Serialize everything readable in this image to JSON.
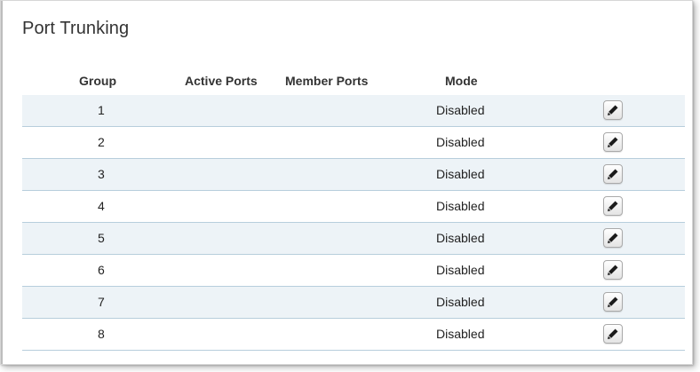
{
  "page": {
    "title": "Port Trunking"
  },
  "table": {
    "headers": {
      "group": "Group",
      "active_ports": "Active Ports",
      "member_ports": "Member Ports",
      "mode": "Mode"
    },
    "rows": [
      {
        "group": "1",
        "active_ports": "",
        "member_ports": "",
        "mode": "Disabled"
      },
      {
        "group": "2",
        "active_ports": "",
        "member_ports": "",
        "mode": "Disabled"
      },
      {
        "group": "3",
        "active_ports": "",
        "member_ports": "",
        "mode": "Disabled"
      },
      {
        "group": "4",
        "active_ports": "",
        "member_ports": "",
        "mode": "Disabled"
      },
      {
        "group": "5",
        "active_ports": "",
        "member_ports": "",
        "mode": "Disabled"
      },
      {
        "group": "6",
        "active_ports": "",
        "member_ports": "",
        "mode": "Disabled"
      },
      {
        "group": "7",
        "active_ports": "",
        "member_ports": "",
        "mode": "Disabled"
      },
      {
        "group": "8",
        "active_ports": "",
        "member_ports": "",
        "mode": "Disabled"
      }
    ],
    "row_action_icon": "pencil-icon"
  },
  "colors": {
    "row_stripe": "#edf3f7",
    "row_divider": "#b7cedc",
    "text": "#333333"
  }
}
